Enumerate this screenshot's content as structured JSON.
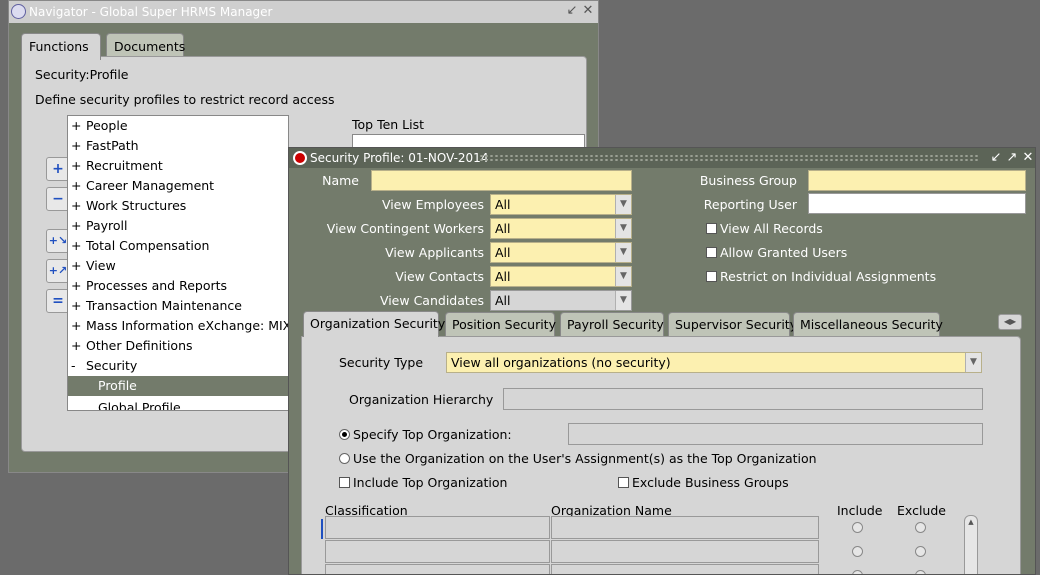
{
  "navigator": {
    "title": "Navigator - Global Super HRMS Manager",
    "tabs": [
      "Functions",
      "Documents"
    ],
    "heading": "Security:Profile",
    "description": "Define security profiles to restrict record access",
    "top_ten_label": "Top Ten List",
    "tree_items": [
      {
        "prefix": "+",
        "label": "People"
      },
      {
        "prefix": "+",
        "label": "FastPath"
      },
      {
        "prefix": "+",
        "label": "Recruitment"
      },
      {
        "prefix": "+",
        "label": "Career Management"
      },
      {
        "prefix": "+",
        "label": "Work Structures"
      },
      {
        "prefix": "+",
        "label": "Payroll"
      },
      {
        "prefix": "+",
        "label": "Total Compensation"
      },
      {
        "prefix": "+",
        "label": "View"
      },
      {
        "prefix": "+",
        "label": "Processes and Reports"
      },
      {
        "prefix": "+",
        "label": "Transaction Maintenance"
      },
      {
        "prefix": "+",
        "label": "Mass Information eXchange: MIX"
      },
      {
        "prefix": "+",
        "label": "Other Definitions"
      },
      {
        "prefix": "-",
        "label": "Security"
      },
      {
        "prefix": "",
        "label": "Profile"
      },
      {
        "prefix": "",
        "label": "Global Profile"
      }
    ],
    "selected_item": "Profile"
  },
  "security_profile": {
    "title": "Security Profile: 01-NOV-2014",
    "name_label": "Name",
    "name_value": "",
    "business_group_label": "Business Group",
    "business_group_value": "",
    "reporting_user_label": "Reporting User",
    "reporting_user_value": "",
    "view_fields": [
      {
        "label": "View Employees",
        "value": "All"
      },
      {
        "label": "View Contingent Workers",
        "value": "All"
      },
      {
        "label": "View Applicants",
        "value": "All"
      },
      {
        "label": "View Contacts",
        "value": "All"
      },
      {
        "label": "View Candidates",
        "value": "All"
      }
    ],
    "checkboxes": [
      "View All Records",
      "Allow Granted Users",
      "Restrict on Individual Assignments"
    ],
    "tabs": [
      "Organization Security",
      "Position Security",
      "Payroll Security",
      "Supervisor Security",
      "Miscellaneous Security"
    ],
    "active_tab": "Organization Security",
    "org": {
      "security_type_label": "Security Type",
      "security_type_value": "View all organizations (no security)",
      "hierarchy_label": "Organization Hierarchy",
      "specify_top_label": "Specify Top Organization:",
      "use_user_org_label": "Use the Organization on the User's Assignment(s) as the Top Organization",
      "include_top_label": "Include Top Organization",
      "exclude_bg_label": "Exclude Business Groups",
      "col_classification": "Classification",
      "col_org_name": "Organization Name",
      "col_include": "Include",
      "col_exclude": "Exclude"
    }
  },
  "colors": {
    "oracle_olive": "#737b6b",
    "field_yellow": "#fcf0b0",
    "panel_gray": "#d6d6d6"
  }
}
